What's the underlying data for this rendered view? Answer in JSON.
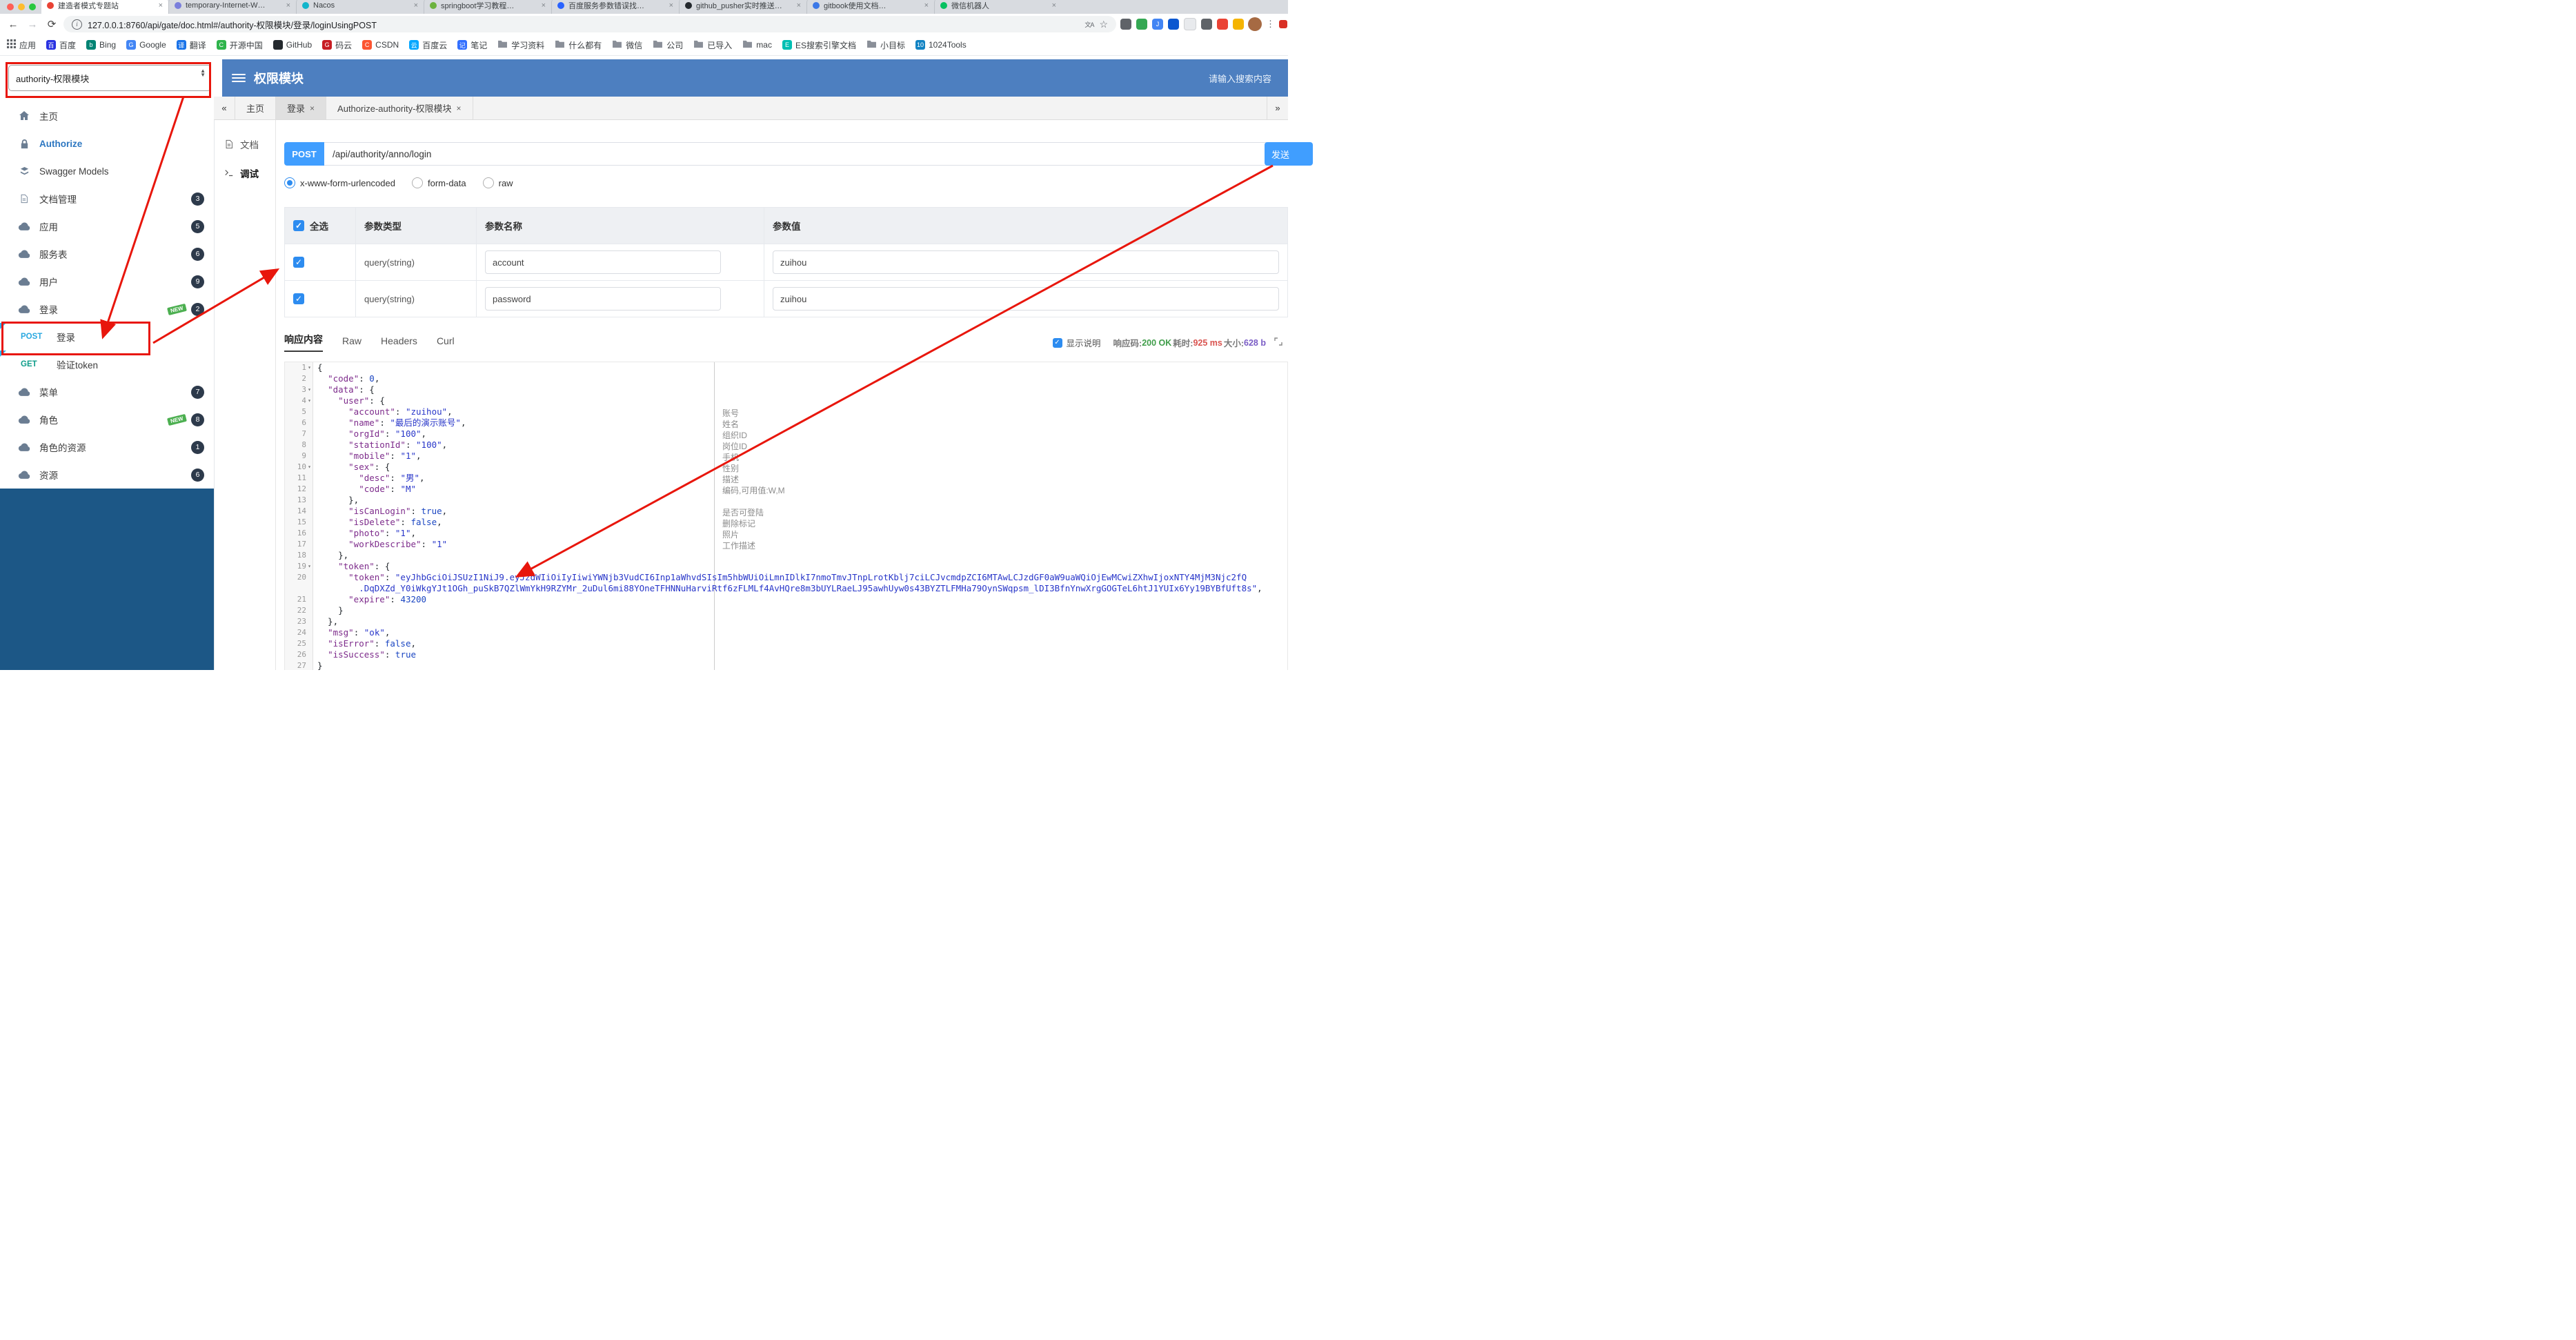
{
  "browser": {
    "traffic_lights": [
      "#ff5f57",
      "#febc2e",
      "#28c840"
    ],
    "tabs": [
      {
        "title": "建造者模式专题站",
        "color": "#e94335",
        "active": true
      },
      {
        "title": "temporary-Internet-W…",
        "color": "#7a7fdc"
      },
      {
        "title": "Nacos",
        "color": "#12b5cb"
      },
      {
        "title": "springboot学习教程…",
        "color": "#6db33f"
      },
      {
        "title": "百度服务参数错误找…",
        "color": "#2962ff"
      },
      {
        "title": "github_pusher实时推送…",
        "color": "#24292e"
      },
      {
        "title": "gitbook使用文档…",
        "color": "#3b78e7"
      },
      {
        "title": "微信机器人",
        "color": "#07c160"
      }
    ],
    "toolbar": {
      "url": "127.0.0.1:8760/api/gate/doc.html#/authority-权限模块/登录/loginUsingPOST",
      "extensions": [
        {
          "color": "#5f6368",
          "text": ""
        },
        {
          "color": "#34a853",
          "text": ""
        },
        {
          "color": "#4285f4",
          "text": "J"
        },
        {
          "color": "#0b57d0",
          "text": ""
        },
        {
          "color": "#e8eaed",
          "text": ""
        },
        {
          "color": "#5f6368",
          "text": ""
        },
        {
          "color": "#ea4335",
          "text": ""
        },
        {
          "color": "#f5b400",
          "text": ""
        }
      ]
    },
    "bookmarks": [
      {
        "label": "应用",
        "type": "apps"
      },
      {
        "label": "百度",
        "type": "chip",
        "text": "百",
        "color": "#2932e1"
      },
      {
        "label": "Bing",
        "type": "chip",
        "text": "b",
        "color": "#008373"
      },
      {
        "label": "Google",
        "type": "chip",
        "text": "G",
        "color": "#4285f4"
      },
      {
        "label": "翻译",
        "type": "chip",
        "text": "译",
        "color": "#1a73e8"
      },
      {
        "label": "开源中国",
        "type": "chip",
        "text": "C",
        "color": "#2fb44c"
      },
      {
        "label": "GitHub",
        "type": "chip",
        "text": "",
        "color": "#24292e"
      },
      {
        "label": "码云",
        "type": "chip",
        "text": "G",
        "color": "#c71d23"
      },
      {
        "label": "CSDN",
        "type": "chip",
        "text": "C",
        "color": "#fc5531"
      },
      {
        "label": "百度云",
        "type": "chip",
        "text": "云",
        "color": "#06a7ff"
      },
      {
        "label": "笔记",
        "type": "chip",
        "text": "记",
        "color": "#3370ff"
      },
      {
        "label": "学习资料",
        "type": "folder"
      },
      {
        "label": "什么都有",
        "type": "folder"
      },
      {
        "label": "微信",
        "type": "folder"
      },
      {
        "label": "公司",
        "type": "folder"
      },
      {
        "label": "已导入",
        "type": "folder"
      },
      {
        "label": "mac",
        "type": "folder"
      },
      {
        "label": "ES搜索引擎文档",
        "type": "chip",
        "text": "E",
        "color": "#00bfb3"
      },
      {
        "label": "小目标",
        "type": "folder"
      },
      {
        "label": "1024Tools",
        "type": "chip",
        "text": "10",
        "color": "#1283c3"
      }
    ]
  },
  "app": {
    "header": {
      "module_select": "authority-权限模块",
      "title": "权限模块",
      "search_placeholder": "请输入搜索内容"
    },
    "sidebar": [
      {
        "label": "主页",
        "icon": "home"
      },
      {
        "label": "Authorize",
        "icon": "lock",
        "accent": true
      },
      {
        "label": "Swagger Models",
        "icon": "models"
      },
      {
        "label": "文档管理",
        "icon": "doc",
        "badge": "3"
      },
      {
        "label": "应用",
        "icon": "cloud",
        "badge": "5"
      },
      {
        "label": "服务表",
        "icon": "cloud",
        "badge": "6"
      },
      {
        "label": "用户",
        "icon": "cloud",
        "badge": "9"
      },
      {
        "label": "登录",
        "icon": "cloud",
        "badge": "2",
        "isNew": true
      },
      {
        "label": "登录",
        "method": "POST",
        "highlight": true
      },
      {
        "label": "验证token",
        "method": "GET"
      },
      {
        "label": "菜单",
        "icon": "cloud",
        "badge": "7"
      },
      {
        "label": "角色",
        "icon": "cloud",
        "badge": "8",
        "isNew": true
      },
      {
        "label": "角色的资源",
        "icon": "cloud",
        "badge": "1"
      },
      {
        "label": "资源",
        "icon": "cloud",
        "badge": "6"
      }
    ],
    "doc_tabs": {
      "prev": "«",
      "next": "»",
      "items": [
        {
          "label": "主页",
          "closable": false,
          "active": false
        },
        {
          "label": "登录",
          "closable": true,
          "active": true
        },
        {
          "label": "Authorize-authority-权限模块",
          "closable": true,
          "active": false
        }
      ]
    },
    "side_tabs": [
      {
        "label": "文档",
        "icon": "doc",
        "active": false
      },
      {
        "label": "调试",
        "icon": "debug",
        "active": true
      }
    ],
    "request": {
      "method": "POST",
      "path": "/api/authority/anno/login",
      "send_label": "发送",
      "content_types": [
        {
          "label": "x-www-form-urlencoded",
          "selected": true
        },
        {
          "label": "form-data",
          "selected": false
        },
        {
          "label": "raw",
          "selected": false
        }
      ]
    },
    "params": {
      "headers": [
        "全选",
        "参数类型",
        "参数名称",
        "参数值"
      ],
      "rows": [
        {
          "checked": true,
          "type": "query(string)",
          "name": "account",
          "value": "zuihou"
        },
        {
          "checked": true,
          "type": "query(string)",
          "name": "password",
          "value": "zuihou"
        }
      ]
    },
    "response": {
      "tabs": [
        {
          "label": "响应内容",
          "active": true
        },
        {
          "label": "Raw",
          "active": false
        },
        {
          "label": "Headers",
          "active": false
        },
        {
          "label": "Curl",
          "active": false
        }
      ],
      "show_desc": "显示说明",
      "meta": [
        {
          "label": "响应码:",
          "value": "200 OK",
          "color": "#3f9d49"
        },
        {
          "label": "耗时:",
          "value": "925 ms",
          "color": "#d9534f"
        },
        {
          "label": "大小:",
          "value": "628 b",
          "color": "#7a5cc5"
        }
      ]
    },
    "code": {
      "lines": [
        {
          "n": 1,
          "fold": true,
          "rows": [
            [
              [
                "p",
                "{"
              ]
            ]
          ]
        },
        {
          "n": 2,
          "rows": [
            [
              [
                "p",
                "  "
              ],
              [
                "k",
                "\"code\""
              ],
              [
                "p",
                ": "
              ],
              [
                "n",
                "0"
              ],
              [
                "p",
                ","
              ]
            ]
          ]
        },
        {
          "n": 3,
          "fold": true,
          "rows": [
            [
              [
                "p",
                "  "
              ],
              [
                "k",
                "\"data\""
              ],
              [
                "p",
                ": {"
              ]
            ]
          ]
        },
        {
          "n": 4,
          "fold": true,
          "rows": [
            [
              [
                "p",
                "    "
              ],
              [
                "k",
                "\"user\""
              ],
              [
                "p",
                ": {"
              ]
            ]
          ]
        },
        {
          "n": 5,
          "rows": [
            [
              [
                "p",
                "      "
              ],
              [
                "k",
                "\"account\""
              ],
              [
                "p",
                ": "
              ],
              [
                "s",
                "\"zuihou\""
              ],
              [
                "p",
                ","
              ]
            ]
          ]
        },
        {
          "n": 6,
          "rows": [
            [
              [
                "p",
                "      "
              ],
              [
                "k",
                "\"name\""
              ],
              [
                "p",
                ": "
              ],
              [
                "s",
                "\"最后的演示账号\""
              ],
              [
                "p",
                ","
              ]
            ]
          ]
        },
        {
          "n": 7,
          "rows": [
            [
              [
                "p",
                "      "
              ],
              [
                "k",
                "\"orgId\""
              ],
              [
                "p",
                ": "
              ],
              [
                "s",
                "\"100\""
              ],
              [
                "p",
                ","
              ]
            ]
          ]
        },
        {
          "n": 8,
          "rows": [
            [
              [
                "p",
                "      "
              ],
              [
                "k",
                "\"stationId\""
              ],
              [
                "p",
                ": "
              ],
              [
                "s",
                "\"100\""
              ],
              [
                "p",
                ","
              ]
            ]
          ]
        },
        {
          "n": 9,
          "rows": [
            [
              [
                "p",
                "      "
              ],
              [
                "k",
                "\"mobile\""
              ],
              [
                "p",
                ": "
              ],
              [
                "s",
                "\"1\""
              ],
              [
                "p",
                ","
              ]
            ]
          ]
        },
        {
          "n": 10,
          "fold": true,
          "rows": [
            [
              [
                "p",
                "      "
              ],
              [
                "k",
                "\"sex\""
              ],
              [
                "p",
                ": {"
              ]
            ]
          ]
        },
        {
          "n": 11,
          "rows": [
            [
              [
                "p",
                "        "
              ],
              [
                "k",
                "\"desc\""
              ],
              [
                "p",
                ": "
              ],
              [
                "s",
                "\"男\""
              ],
              [
                "p",
                ","
              ]
            ]
          ]
        },
        {
          "n": 12,
          "rows": [
            [
              [
                "p",
                "        "
              ],
              [
                "k",
                "\"code\""
              ],
              [
                "p",
                ": "
              ],
              [
                "s",
                "\"M\""
              ]
            ]
          ]
        },
        {
          "n": 13,
          "rows": [
            [
              [
                "p",
                "      },"
              ]
            ]
          ]
        },
        {
          "n": 14,
          "rows": [
            [
              [
                "p",
                "      "
              ],
              [
                "k",
                "\"isCanLogin\""
              ],
              [
                "p",
                ": "
              ],
              [
                "b",
                "true"
              ],
              [
                "p",
                ","
              ]
            ]
          ]
        },
        {
          "n": 15,
          "rows": [
            [
              [
                "p",
                "      "
              ],
              [
                "k",
                "\"isDelete\""
              ],
              [
                "p",
                ": "
              ],
              [
                "b",
                "false"
              ],
              [
                "p",
                ","
              ]
            ]
          ]
        },
        {
          "n": 16,
          "rows": [
            [
              [
                "p",
                "      "
              ],
              [
                "k",
                "\"photo\""
              ],
              [
                "p",
                ": "
              ],
              [
                "s",
                "\"1\""
              ],
              [
                "p",
                ","
              ]
            ]
          ]
        },
        {
          "n": 17,
          "rows": [
            [
              [
                "p",
                "      "
              ],
              [
                "k",
                "\"workDescribe\""
              ],
              [
                "p",
                ": "
              ],
              [
                "s",
                "\"1\""
              ]
            ]
          ]
        },
        {
          "n": 18,
          "rows": [
            [
              [
                "p",
                "    },"
              ]
            ]
          ]
        },
        {
          "n": 19,
          "fold": true,
          "rows": [
            [
              [
                "p",
                "    "
              ],
              [
                "k",
                "\"token\""
              ],
              [
                "p",
                ": {"
              ]
            ]
          ]
        },
        {
          "n": 20,
          "rows": [
            [
              [
                "p",
                "      "
              ],
              [
                "k",
                "\"token\""
              ],
              [
                "p",
                ": "
              ],
              [
                "s",
                "\"eyJhbGciOiJSUzI1NiJ9.eyJzdWIiOiIyIiwiYWNjb3VudCI6Inp1aWhvdSIsIm5hbWUiOiLmnIDlkI7nmoTmvJTnpLrotKblj7ciLCJvcmdpZCI6MTAwLCJzdGF0aW9uaWQiOjEwMCwiZXhwIjoxNTY4MjM3Njc2fQ"
              ]
            ],
            [
              [
                "p",
                "        "
              ],
              [
                "s",
                ".DqDXZd_Y0iWkgYJt1OGh_puSkB7QZlWmYkH9RZYMr_2uDul6mi88YOneTFHNNuHarviRtf6zFLMLf4AvHQre8m3bUYLRaeLJ95awhUyw0s43BYZTLFMHa79OynSWqpsm_lDI3BfnYnwXrgGOGTeL6htJ1YUIx6Yy19BYBfUft8s\""
              ],
              [
                "p",
                ","
              ]
            ]
          ]
        },
        {
          "n": 21,
          "rows": [
            [
              [
                "p",
                "      "
              ],
              [
                "k",
                "\"expire\""
              ],
              [
                "p",
                ": "
              ],
              [
                "n",
                "43200"
              ]
            ]
          ]
        },
        {
          "n": 22,
          "rows": [
            [
              [
                "p",
                "    }"
              ]
            ]
          ]
        },
        {
          "n": 23,
          "rows": [
            [
              [
                "p",
                "  },"
              ]
            ]
          ]
        },
        {
          "n": 24,
          "rows": [
            [
              [
                "p",
                "  "
              ],
              [
                "k",
                "\"msg\""
              ],
              [
                "p",
                ": "
              ],
              [
                "s",
                "\"ok\""
              ],
              [
                "p",
                ","
              ]
            ]
          ]
        },
        {
          "n": 25,
          "rows": [
            [
              [
                "p",
                "  "
              ],
              [
                "k",
                "\"isError\""
              ],
              [
                "p",
                ": "
              ],
              [
                "b",
                "false"
              ],
              [
                "p",
                ","
              ]
            ]
          ]
        },
        {
          "n": 26,
          "rows": [
            [
              [
                "p",
                "  "
              ],
              [
                "k",
                "\"isSuccess\""
              ],
              [
                "p",
                ": "
              ],
              [
                "b",
                "true"
              ]
            ]
          ]
        },
        {
          "n": 27,
          "rows": [
            [
              [
                "p",
                "}"
              ]
            ]
          ]
        }
      ],
      "annotations": [
        {
          "line": 5,
          "text": "账号"
        },
        {
          "line": 6,
          "text": "姓名"
        },
        {
          "line": 7,
          "text": "组织ID"
        },
        {
          "line": 8,
          "text": "岗位ID"
        },
        {
          "line": 9,
          "text": "手机"
        },
        {
          "line": 10,
          "text": "性别"
        },
        {
          "line": 11,
          "text": "描述"
        },
        {
          "line": 12,
          "text": "编码,可用值:W,M"
        },
        {
          "line": 14,
          "text": "是否可登陆"
        },
        {
          "line": 15,
          "text": "删除标记"
        },
        {
          "line": 16,
          "text": "照片"
        },
        {
          "line": 17,
          "text": "工作描述"
        }
      ]
    }
  }
}
